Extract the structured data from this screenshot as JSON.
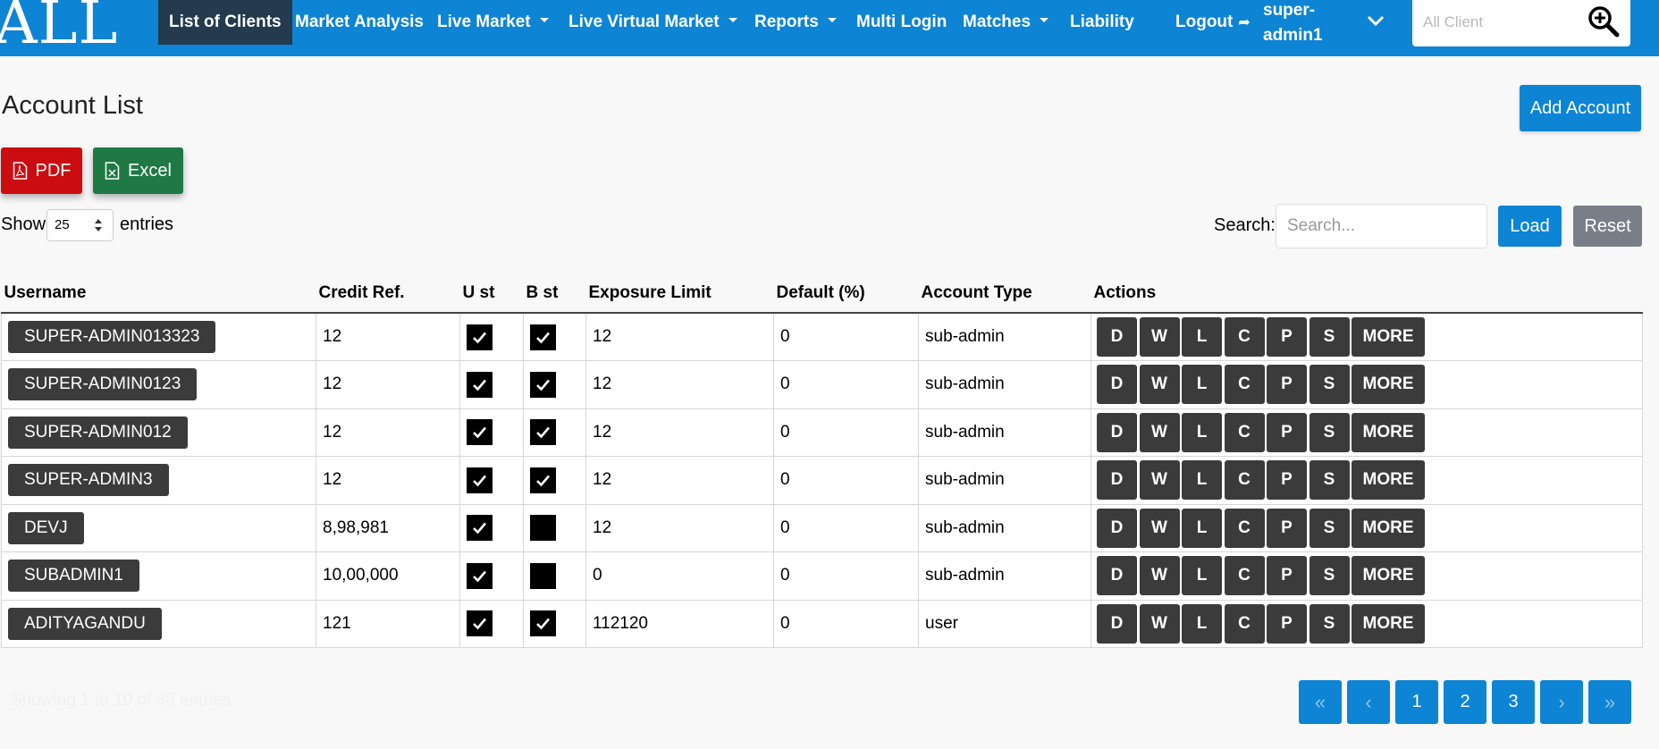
{
  "nav": {
    "logo": "ALL",
    "items": [
      {
        "label": "List of Clients",
        "active": true,
        "dropdown": false
      },
      {
        "label": "Market Analysis",
        "dropdown": false
      },
      {
        "label": "Live Market",
        "dropdown": true
      },
      {
        "label": "Live Virtual Market",
        "dropdown": true
      },
      {
        "label": "Reports",
        "dropdown": true
      },
      {
        "label": "Multi Login",
        "dropdown": false
      },
      {
        "label": "Matches",
        "dropdown": true
      },
      {
        "label": "Liability",
        "dropdown": false
      }
    ],
    "logout_label": "Logout",
    "user_line1": "super-",
    "user_line2": "admin1",
    "search_placeholder": "All Client"
  },
  "page": {
    "title": "Account List",
    "add_account_label": "Add Account",
    "pdf_label": "PDF",
    "excel_label": "Excel",
    "show_label": "Show",
    "entries_value": "25",
    "entries_label": "entries",
    "search_label": "Search:",
    "search_placeholder": "Search...",
    "load_label": "Load",
    "reset_label": "Reset"
  },
  "table": {
    "headers": [
      "Username",
      "Credit Ref.",
      "U st",
      "B st",
      "Exposure Limit",
      "Default (%)",
      "Account Type",
      "Actions"
    ],
    "rows": [
      {
        "username": "SUPER-ADMIN013323",
        "credit_ref": "12",
        "u_st": true,
        "b_st": true,
        "exposure": "12",
        "default": "0",
        "type": "sub-admin"
      },
      {
        "username": "SUPER-ADMIN0123",
        "credit_ref": "12",
        "u_st": true,
        "b_st": true,
        "exposure": "12",
        "default": "0",
        "type": "sub-admin"
      },
      {
        "username": "SUPER-ADMIN012",
        "credit_ref": "12",
        "u_st": true,
        "b_st": true,
        "exposure": "12",
        "default": "0",
        "type": "sub-admin"
      },
      {
        "username": "SUPER-ADMIN3",
        "credit_ref": "12",
        "u_st": true,
        "b_st": true,
        "exposure": "12",
        "default": "0",
        "type": "sub-admin"
      },
      {
        "username": "DEVJ",
        "credit_ref": "8,98,981",
        "u_st": true,
        "b_st": false,
        "exposure": "12",
        "default": "0",
        "type": "sub-admin"
      },
      {
        "username": "SUBADMIN1",
        "credit_ref": "10,00,000",
        "u_st": true,
        "b_st": false,
        "exposure": "0",
        "default": "0",
        "type": "sub-admin"
      },
      {
        "username": "ADITYAGANDU",
        "credit_ref": "121",
        "u_st": true,
        "b_st": true,
        "exposure": "112120",
        "default": "0",
        "type": "user"
      }
    ],
    "action_buttons": [
      "D",
      "W",
      "L",
      "C",
      "P",
      "S",
      "MORE"
    ]
  },
  "footer": {
    "info": "Showing 1 to 10 of 30 entries",
    "pagination": [
      "«",
      "‹",
      "1",
      "2",
      "3",
      "›",
      "»"
    ]
  },
  "colors": {
    "brand": "#0d84d4",
    "nav_active": "#243a4e",
    "pdf": "#cb0c10",
    "excel": "#1f7945",
    "dark_button": "#3b3b3b",
    "reset": "#787f88"
  }
}
